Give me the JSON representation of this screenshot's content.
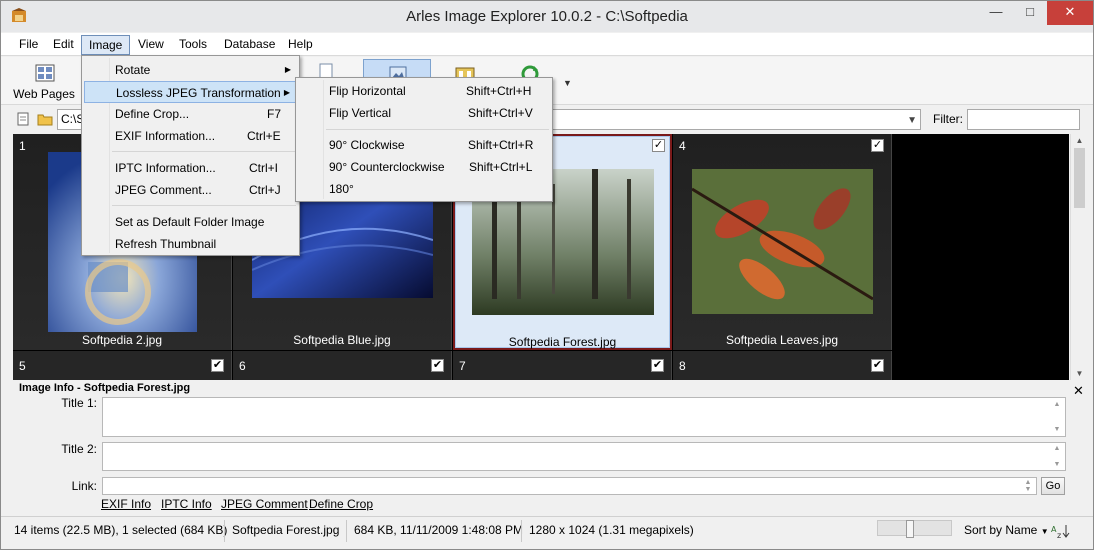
{
  "window": {
    "title": "Arles Image Explorer 10.0.2 - C:\\Softpedia"
  },
  "menubar": {
    "items": [
      "File",
      "Edit",
      "Image",
      "View",
      "Tools",
      "Database",
      "Help"
    ]
  },
  "toolbar": {
    "web_pages_label": "Web Pages"
  },
  "address": {
    "path": "C:\\S",
    "filter_label": "Filter:",
    "filter_value": ""
  },
  "grid": {
    "row1": [
      {
        "num": "1",
        "caption": "Softpedia 2.jpg",
        "checked": false
      },
      {
        "num": "",
        "caption": "Softpedia Blue.jpg",
        "checked": false
      },
      {
        "num": "",
        "caption": "Softpedia Forest.jpg",
        "checked": true
      },
      {
        "num": "4",
        "caption": "Softpedia Leaves.jpg",
        "checked": true
      }
    ],
    "row2": [
      {
        "num": "5",
        "check": "✔"
      },
      {
        "num": "6",
        "check": "✔"
      },
      {
        "num": "7",
        "check": "✔"
      },
      {
        "num": "8",
        "check": "✔"
      }
    ]
  },
  "info": {
    "title": "Image Info - Softpedia Forest.jpg",
    "title1_label": "Title 1:",
    "title2_label": "Title 2:",
    "link_label": "Link:",
    "go_label": "Go",
    "links": [
      "EXIF Info",
      "IPTC Info",
      "JPEG Comment",
      "Define Crop"
    ]
  },
  "status": {
    "items": "14 items (22.5 MB), 1 selected (684 KB)",
    "filename": "Softpedia Forest.jpg",
    "size_date": "684 KB, 11/11/2009 1:48:08 PM",
    "dimensions": "1280 x 1024 (1.31 megapixels)",
    "sort": "Sort by Name"
  },
  "image_menu": {
    "items": [
      {
        "label": "Rotate",
        "shortcut": "",
        "submenu": true
      },
      {
        "label": "Lossless JPEG Transformation",
        "shortcut": "",
        "submenu": true
      },
      {
        "label": "Define Crop...",
        "shortcut": "F7"
      },
      {
        "label": "EXIF Information...",
        "shortcut": "Ctrl+E"
      },
      {
        "label": "IPTC Information...",
        "shortcut": "Ctrl+I"
      },
      {
        "label": "JPEG Comment...",
        "shortcut": "Ctrl+J"
      },
      {
        "label": "Set as Default Folder Image",
        "shortcut": ""
      },
      {
        "label": "Refresh Thumbnail",
        "shortcut": ""
      }
    ]
  },
  "jpeg_submenu": {
    "items": [
      {
        "label": "Flip Horizontal",
        "shortcut": "Shift+Ctrl+H"
      },
      {
        "label": "Flip Vertical",
        "shortcut": "Shift+Ctrl+V"
      },
      {
        "label": "90° Clockwise",
        "shortcut": "Shift+Ctrl+R"
      },
      {
        "label": "90° Counterclockwise",
        "shortcut": "Shift+Ctrl+L"
      },
      {
        "label": "180°",
        "shortcut": ""
      }
    ]
  },
  "icons": [
    "app-icon",
    "web-pages-icon",
    "folder-icon",
    "checkbox-icon",
    "sort-icon"
  ],
  "colors": {
    "selection": "#cde3f7",
    "close": "#c7403a",
    "selected_frame": "#7a1a1a"
  }
}
